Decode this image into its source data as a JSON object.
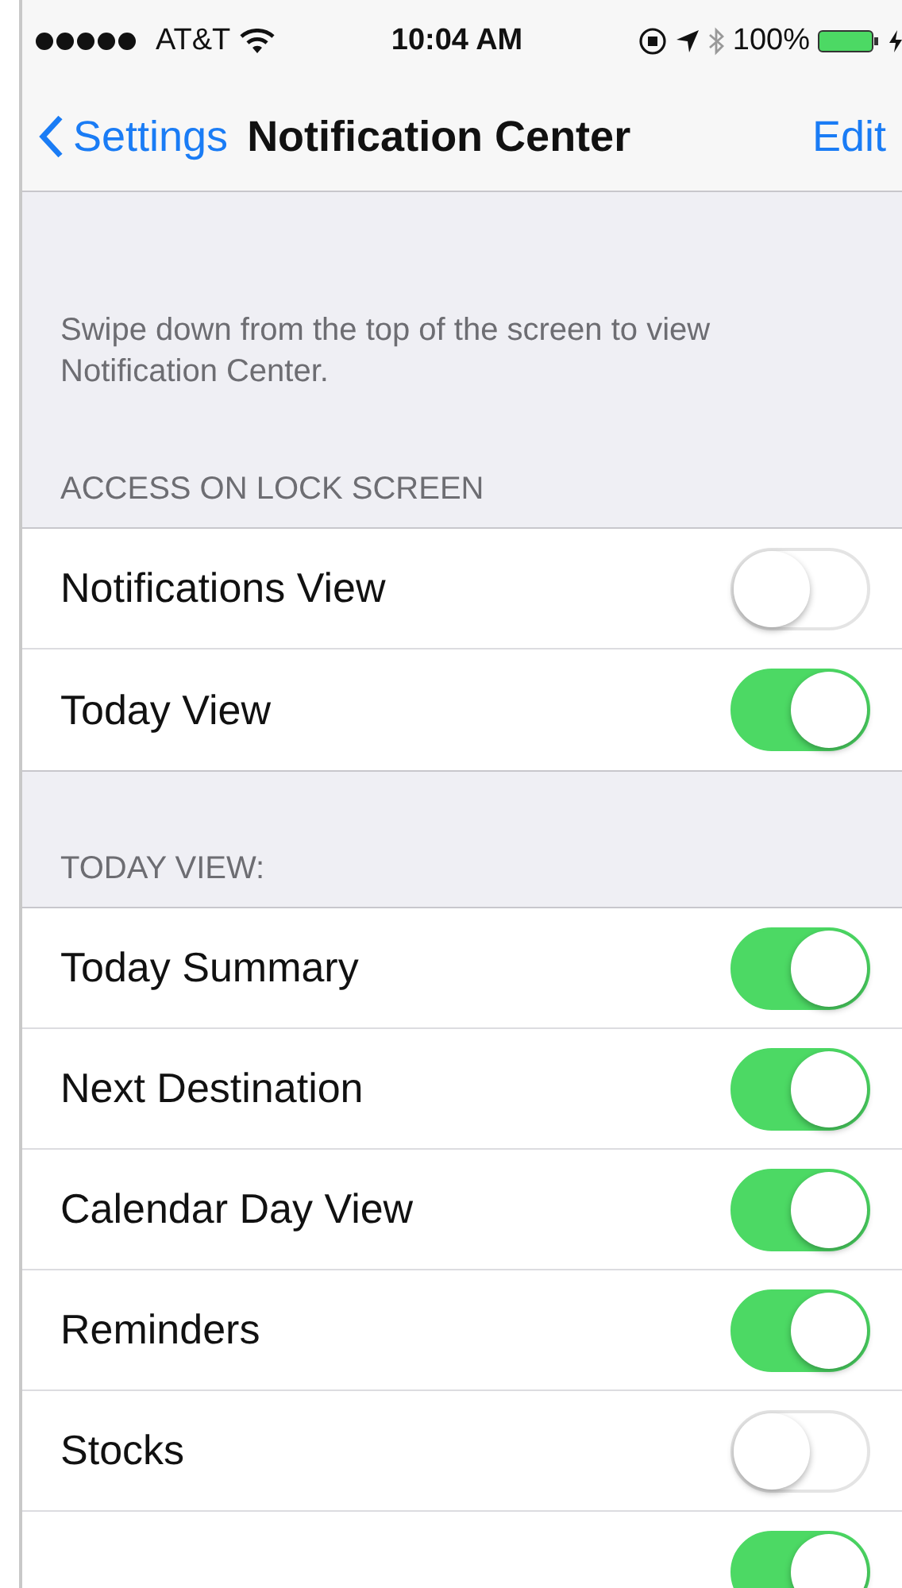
{
  "status_bar": {
    "carrier": "AT&T",
    "time": "10:04 AM",
    "battery": "100%"
  },
  "nav_bar": {
    "back": "Settings",
    "title": "Notification Center",
    "action": "Edit"
  },
  "intro": "Swipe down from the top of the screen to view Notification Center.",
  "sections": [
    {
      "header": "ACCESS ON LOCK SCREEN",
      "rows": [
        {
          "label": "Notifications View",
          "on": false
        },
        {
          "label": "Today View",
          "on": true
        }
      ]
    },
    {
      "header": "TODAY VIEW:",
      "rows": [
        {
          "label": "Today Summary",
          "on": true
        },
        {
          "label": "Next Destination",
          "on": true
        },
        {
          "label": "Calendar Day View",
          "on": true
        },
        {
          "label": "Reminders",
          "on": true
        },
        {
          "label": "Stocks",
          "on": false
        },
        {
          "on": true
        }
      ]
    }
  ]
}
